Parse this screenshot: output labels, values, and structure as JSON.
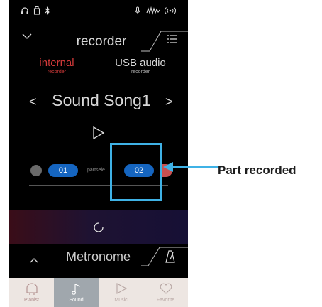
{
  "status_bar": {
    "icons": [
      "headphones-icon",
      "usb-memory-icon",
      "bluetooth-icon",
      "microphone-icon",
      "audio-wave-icon",
      "wireless-icon"
    ]
  },
  "header": {
    "title": "recorder",
    "left_icon": "chevron-down-icon",
    "right_icon": "menu-icon"
  },
  "source_tabs": [
    {
      "label": "internal",
      "sub": "recorder",
      "selected": true,
      "color": "#d33a3a"
    },
    {
      "label": "USB audio",
      "sub": "recorder",
      "selected": false
    }
  ],
  "song": {
    "prev": "<",
    "name": "Sound Song1",
    "next": ">"
  },
  "parts": {
    "part1": "01",
    "label": "partsele",
    "part2": "02"
  },
  "metronome": {
    "label": "Metronome"
  },
  "nav": [
    {
      "label": "Pianist",
      "icon": "piano-icon"
    },
    {
      "label": "Sound",
      "icon": "music-note-icon",
      "active": true
    },
    {
      "label": "Music",
      "icon": "play-icon"
    },
    {
      "label": "Favorite",
      "icon": "heart-icon"
    }
  ],
  "callout": {
    "label": "Part recorded",
    "color": "#3fb2e6"
  }
}
